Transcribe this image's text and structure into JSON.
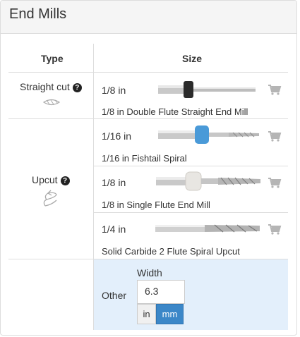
{
  "panel": {
    "title": "End Mills"
  },
  "table": {
    "headers": {
      "type": "Type",
      "size": "Size"
    },
    "groups": [
      {
        "type": "Straight cut",
        "icon": "straight-cut-icon"
      },
      {
        "type": "Upcut",
        "icon": "upcut-icon"
      }
    ],
    "rows": [
      {
        "size": "1/8 in",
        "name": "1/8 in Double Flute Straight End Mill"
      },
      {
        "size": "1/16 in",
        "name": "1/16 in Fishtail Spiral"
      },
      {
        "size": "1/8 in",
        "name": "1/8 in Single Flute End Mill"
      },
      {
        "size": "1/4 in",
        "name": "Solid Carbide 2 Flute Spiral Upcut"
      }
    ],
    "other": {
      "label": "Other",
      "width_label": "Width",
      "width_value": "6.3",
      "units": [
        "in",
        "mm"
      ],
      "selected_unit": "mm"
    }
  },
  "colors": {
    "accent": "#3b87c8",
    "other_bg": "#e3effb",
    "cart": "#b5b5b5"
  }
}
